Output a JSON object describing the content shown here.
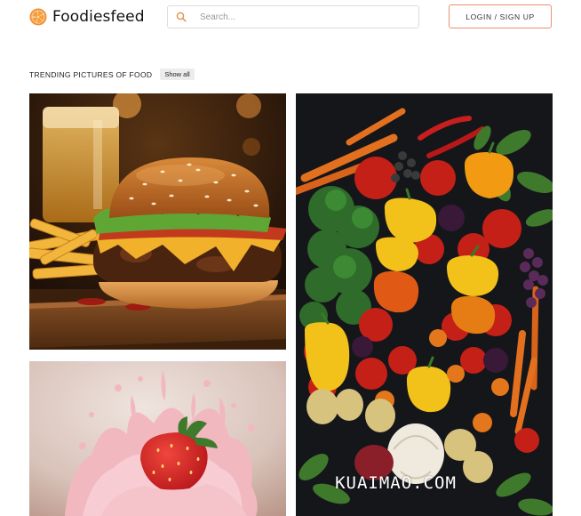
{
  "header": {
    "brand": "Foodiesfeed",
    "search_placeholder": "Search...",
    "login_label": "LOGIN / SIGN UP"
  },
  "section": {
    "title": "TRENDING PICTURES OF FOOD",
    "show_all": "Show all"
  },
  "photos": [
    {
      "subject": "burger-with-fries"
    },
    {
      "subject": "vegetables-flatlay"
    },
    {
      "subject": "strawberry-milk-splash"
    }
  ],
  "watermark": "KUAIMAO.COM",
  "colors": {
    "brand_orange": "#f28c38",
    "button_border": "#e8906f"
  }
}
